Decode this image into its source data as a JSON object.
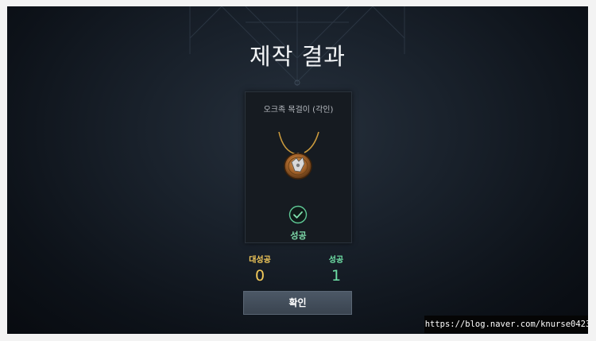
{
  "screen": {
    "title": "제작 결과"
  },
  "result_card": {
    "item_name": "오크족 목걸이 (각인)",
    "item_icon": "necklace-icon",
    "status_icon": "check-circle-icon",
    "status_label": "성공"
  },
  "stats": {
    "great_success_label": "대성공",
    "great_success_count": "0",
    "success_label": "성공",
    "success_count": "1"
  },
  "actions": {
    "confirm_label": "확인"
  },
  "watermark": {
    "text": "https://blog.naver.com/knurse0423"
  },
  "colors": {
    "success_green": "#6fe0a6",
    "great_success_gold": "#f2c95a",
    "background_dark": "#0d1219"
  }
}
